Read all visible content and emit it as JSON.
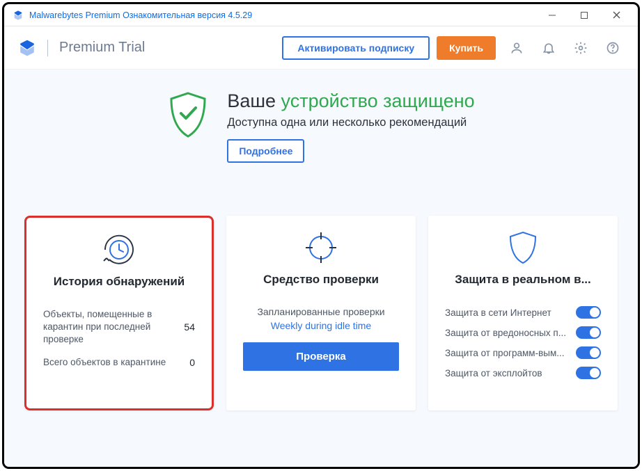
{
  "window": {
    "title": "Malwarebytes Premium Ознакомительная версия  4.5.29"
  },
  "header": {
    "app_name": "Premium Trial",
    "activate_btn": "Активировать подписку",
    "buy_btn": "Купить"
  },
  "status": {
    "prefix": "Ваше",
    "highlight": "устройство защищено",
    "subtitle": "Доступна одна или несколько рекомендаций",
    "details_btn": "Подробнее"
  },
  "cards": {
    "history": {
      "title": "История обнаружений",
      "row1_label": "Объекты, помещенные в карантин при последней проверке",
      "row1_value": "54",
      "row2_label": "Всего объектов в карантине",
      "row2_value": "0"
    },
    "scanner": {
      "title": "Средство проверки",
      "scheduled_label": "Запланированные проверки",
      "schedule_link": "Weekly during idle time",
      "scan_btn": "Проверка"
    },
    "protection": {
      "title": "Защита в реальном в...",
      "toggles": [
        {
          "label": "Защита в сети Интернет",
          "on": true
        },
        {
          "label": "Защита от вредоносных п...",
          "on": true
        },
        {
          "label": "Защита от программ-вым...",
          "on": true
        },
        {
          "label": "Защита от эксплойтов",
          "on": true
        }
      ]
    }
  }
}
